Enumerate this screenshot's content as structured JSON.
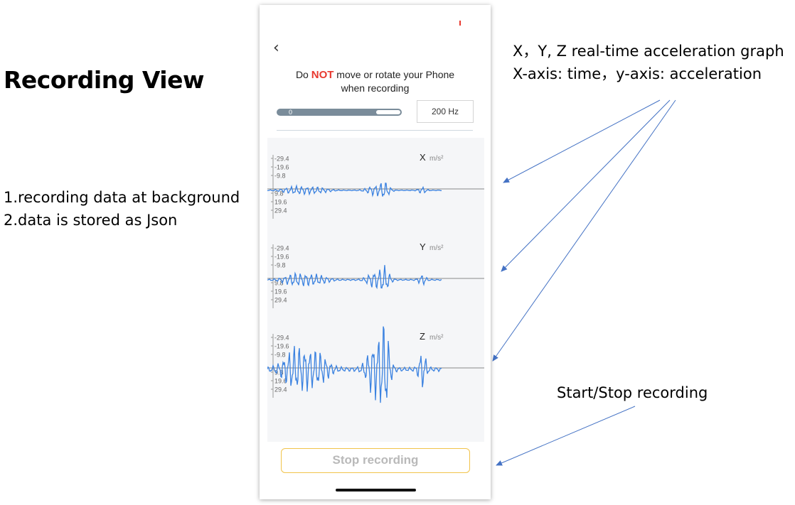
{
  "slide": {
    "title": "Recording View",
    "notes": [
      "1.recording data at background",
      "2.data is stored as Json"
    ],
    "annotations": {
      "graph_line1": "X，Y, Z real-time acceleration graph",
      "graph_line2": "X-axis: time，y-axis: acceleration",
      "start_stop": "Start/Stop recording"
    }
  },
  "app": {
    "back_icon": "chevron-left-icon",
    "warning": {
      "before": "Do ",
      "emphasis": "NOT",
      "after": " move or rotate your Phone",
      "line2": "when recording"
    },
    "progress": {
      "label": "0",
      "fraction": 0.2
    },
    "sample_rate": "200 Hz",
    "charts": [
      {
        "axis": "X",
        "unit": "m/s²",
        "ticks": [
          "-29.4",
          "-19.6",
          "-9.8",
          "9.8",
          "19.6",
          "29.4"
        ]
      },
      {
        "axis": "Y",
        "unit": "m/s²",
        "ticks": [
          "-29.4",
          "-19.6",
          "-9.8",
          "9.8",
          "19.6",
          "29.4"
        ]
      },
      {
        "axis": "Z",
        "unit": "m/s²",
        "ticks": [
          "-29.4",
          "-19.6",
          "-9.8",
          "9.8",
          "19.6",
          "29.4"
        ]
      }
    ],
    "stop_button": "Stop recording",
    "colors": {
      "signal": "#3b82e0",
      "warning": "#e8392f",
      "button_border": "#f1c34a",
      "annotation_arrow": "#4472c4"
    }
  }
}
